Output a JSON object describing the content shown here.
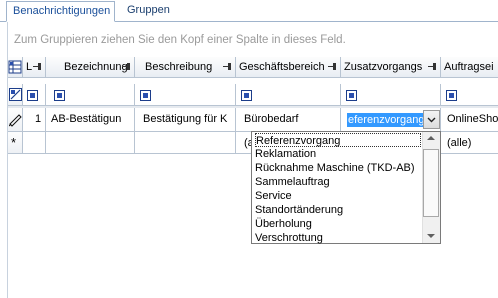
{
  "tabs": [
    {
      "label": "Benachrichtigungen",
      "active": true
    },
    {
      "label": "Gruppen",
      "active": false
    }
  ],
  "group_hint": "Zum Gruppieren ziehen Sie den Kopf einer Spalte in dieses Feld.",
  "columns": [
    {
      "label": "L"
    },
    {
      "label": "Bezeichnung"
    },
    {
      "label": "Beschreibung"
    },
    {
      "label": "Geschäftsbereich"
    },
    {
      "label": "Zusatzvorgangs"
    },
    {
      "label": "Auftragsei"
    }
  ],
  "row1": {
    "num": "1",
    "bezeichnung": "AB-Bestätigun",
    "beschreibung": "Bestätigung für K",
    "geschaeftsbereich": "Bürobedarf",
    "zusatzvorgang": "eferenzvorgang",
    "auftragseingang": "OnlineSho"
  },
  "newrow": {
    "geschaeftsbereich": "(a",
    "auftragseingang": "(alle)"
  },
  "dropdown": {
    "options": [
      "Referenzvorgang",
      "Reklamation",
      "Rücknahme Maschine (TKD-AB)",
      "Sammelauftrag",
      "Service",
      "Standortänderung",
      "Überholung",
      "Verschrottung"
    ]
  },
  "colors": {
    "tab_text": "#1a4f9a",
    "highlight": "#3399ff",
    "grid_line": "#b8c4d2"
  }
}
